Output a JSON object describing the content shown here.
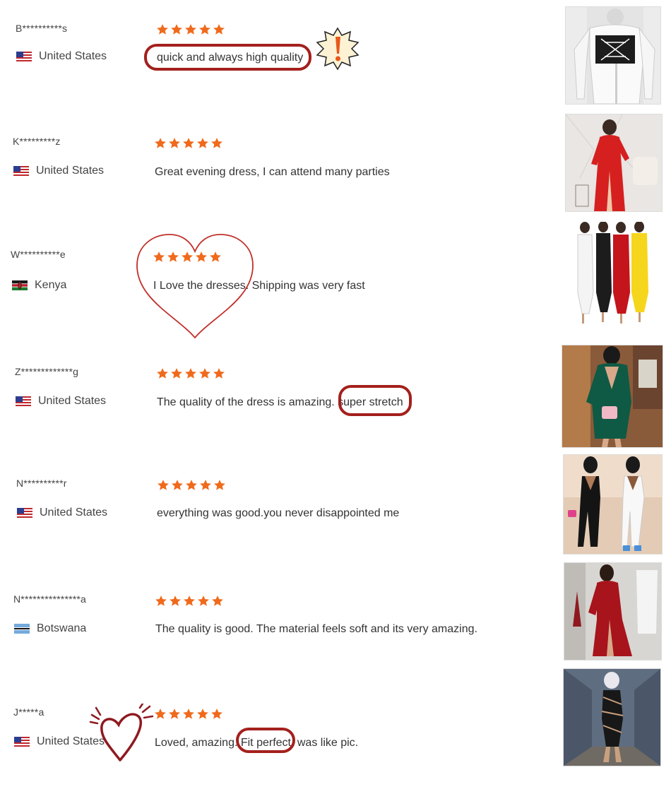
{
  "reviews": [
    {
      "name": "B**********s",
      "country": "United States",
      "flag": "us",
      "rating": 5,
      "text": "quick and always high quality"
    },
    {
      "name": "K*********z",
      "country": "United States",
      "flag": "us",
      "rating": 5,
      "text": "Great evening dress, I can attend many parties"
    },
    {
      "name": "W**********e",
      "country": "Kenya",
      "flag": "ke",
      "rating": 5,
      "text": "I Love the dresses. Shipping was very fast"
    },
    {
      "name": "Z*************g",
      "country": "United States",
      "flag": "us",
      "rating": 5,
      "text": "The quality of the dress is amazing. super stretch"
    },
    {
      "name": "N**********r",
      "country": "United States",
      "flag": "us",
      "rating": 5,
      "text": "everything was good.you never disappointed me"
    },
    {
      "name": "N***************a",
      "country": "Botswana",
      "flag": "bw",
      "rating": 5,
      "text": "The quality is good. The material feels soft and its very amazing."
    },
    {
      "name": "J*****a",
      "country": "United States",
      "flag": "us",
      "rating": 5,
      "text": "Loved, amazing. Fit perfect, was like pic."
    }
  ],
  "colors": {
    "star": "#f06a1c",
    "annotation": "#a3201c"
  }
}
